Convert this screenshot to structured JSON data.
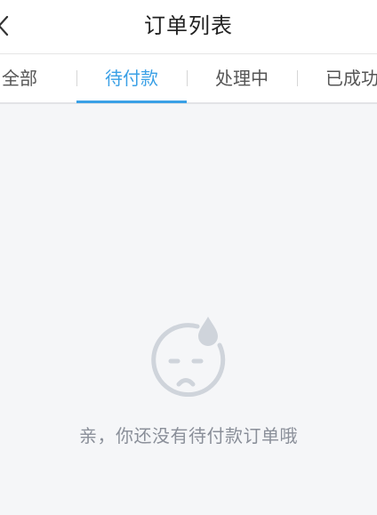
{
  "header": {
    "title": "订单列表",
    "back_icon": "chevron-left-icon"
  },
  "tabs": [
    {
      "label": "全部",
      "active": false
    },
    {
      "label": "待付款",
      "active": true
    },
    {
      "label": "处理中",
      "active": false
    },
    {
      "label": "已成功",
      "active": false
    }
  ],
  "empty_state": {
    "icon": "sweating-face-icon",
    "message": "亲，你还没有待付款订单哦"
  },
  "colors": {
    "accent": "#3aa0e6",
    "background": "#f5f6f8",
    "muted_text": "#8a8f99",
    "icon": "#cfd4db"
  }
}
